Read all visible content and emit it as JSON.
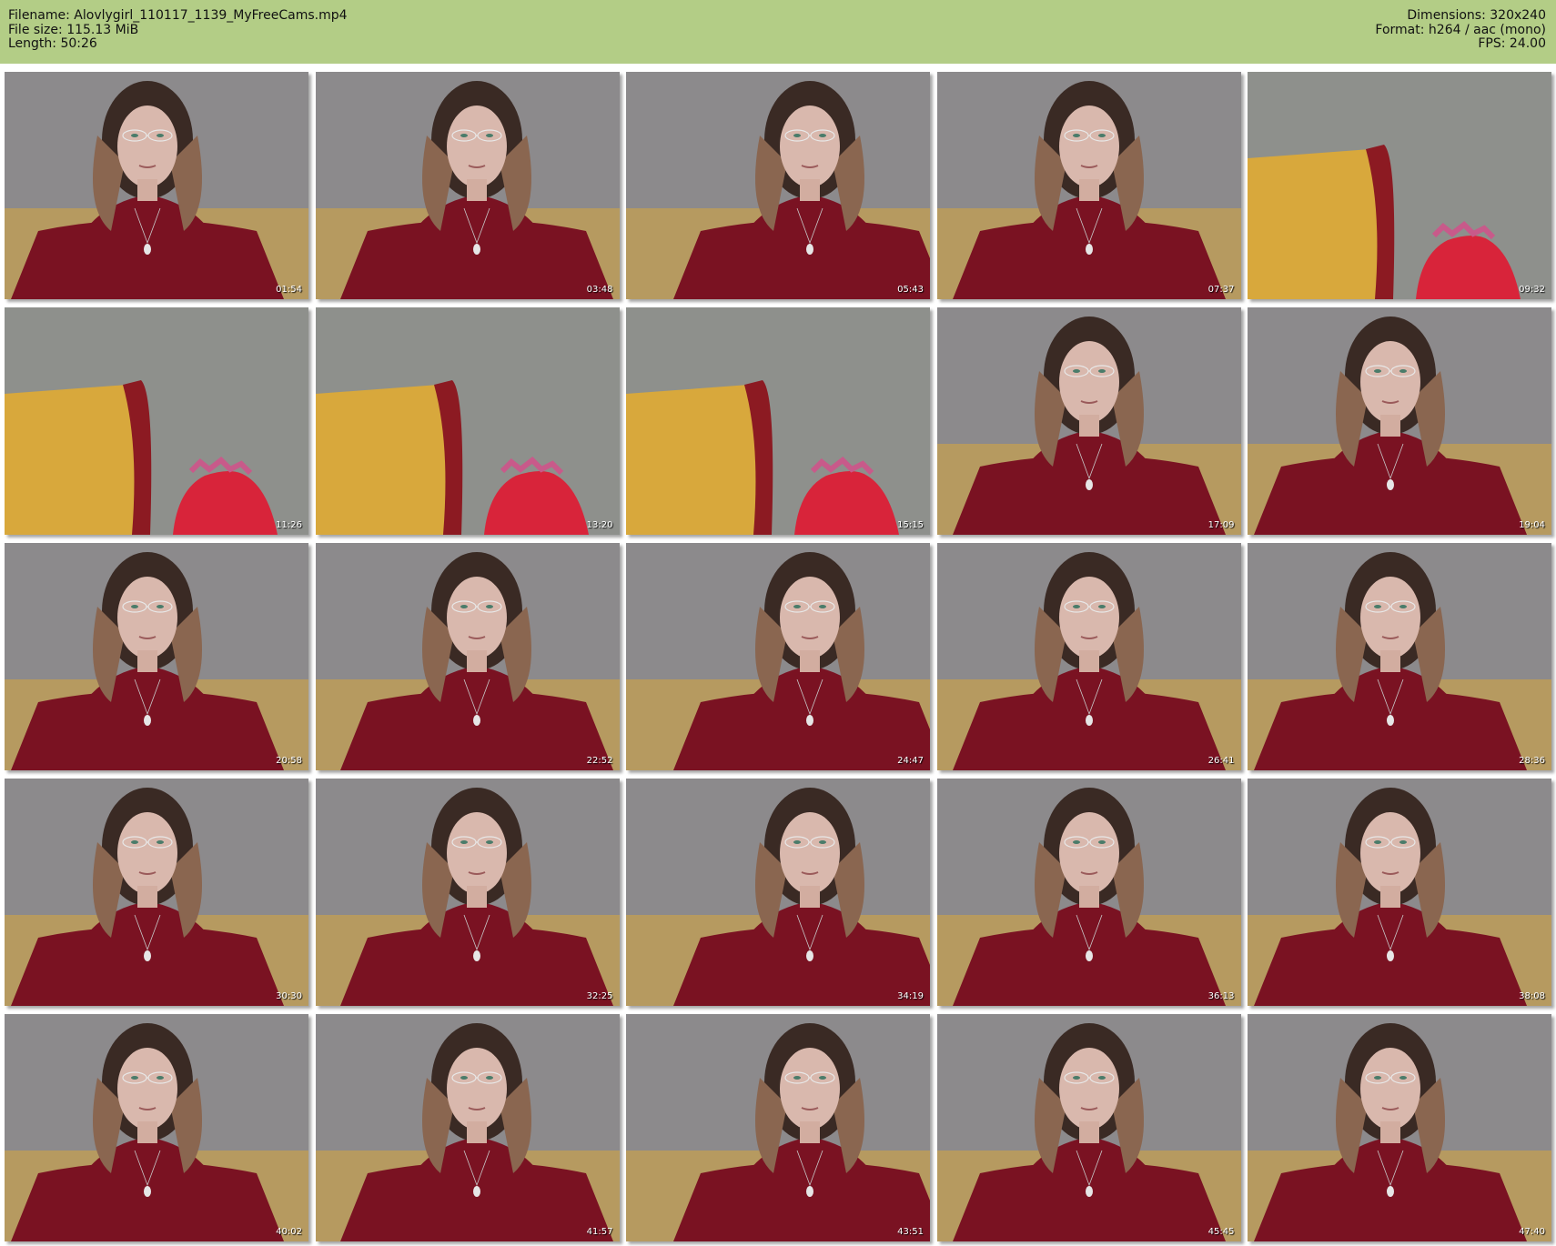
{
  "header": {
    "filename_line": "Filename: Alovlygirl_110117_1139_MyFreeCams.mp4",
    "filesize_line": "File size: 115.13 MiB",
    "length_line": "Length: 50:26",
    "dimensions_line": "Dimensions: 320x240",
    "format_line": "Format: h264 / aac (mono)",
    "fps_line": "FPS: 24.00"
  },
  "colors": {
    "header_bg": "#b3cd86",
    "wall": "#8c8a8c",
    "shirt": "#7a1222",
    "pillow": "#d8a83c",
    "toy": "#d8243a"
  },
  "thumbnails": [
    {
      "time": "01:54",
      "scene": "person"
    },
    {
      "time": "03:48",
      "scene": "person"
    },
    {
      "time": "05:43",
      "scene": "person"
    },
    {
      "time": "07:37",
      "scene": "person"
    },
    {
      "time": "09:32",
      "scene": "pillow"
    },
    {
      "time": "11:26",
      "scene": "pillow"
    },
    {
      "time": "13:20",
      "scene": "pillow"
    },
    {
      "time": "15:15",
      "scene": "pillow"
    },
    {
      "time": "17:09",
      "scene": "person"
    },
    {
      "time": "19:04",
      "scene": "person"
    },
    {
      "time": "20:58",
      "scene": "person"
    },
    {
      "time": "22:52",
      "scene": "person"
    },
    {
      "time": "24:47",
      "scene": "person"
    },
    {
      "time": "26:41",
      "scene": "person"
    },
    {
      "time": "28:36",
      "scene": "person"
    },
    {
      "time": "30:30",
      "scene": "person"
    },
    {
      "time": "32:25",
      "scene": "person"
    },
    {
      "time": "34:19",
      "scene": "person"
    },
    {
      "time": "36:13",
      "scene": "person"
    },
    {
      "time": "38:08",
      "scene": "person"
    },
    {
      "time": "40:02",
      "scene": "person"
    },
    {
      "time": "41:57",
      "scene": "person"
    },
    {
      "time": "43:51",
      "scene": "person"
    },
    {
      "time": "45:45",
      "scene": "person"
    },
    {
      "time": "47:40",
      "scene": "person"
    }
  ]
}
